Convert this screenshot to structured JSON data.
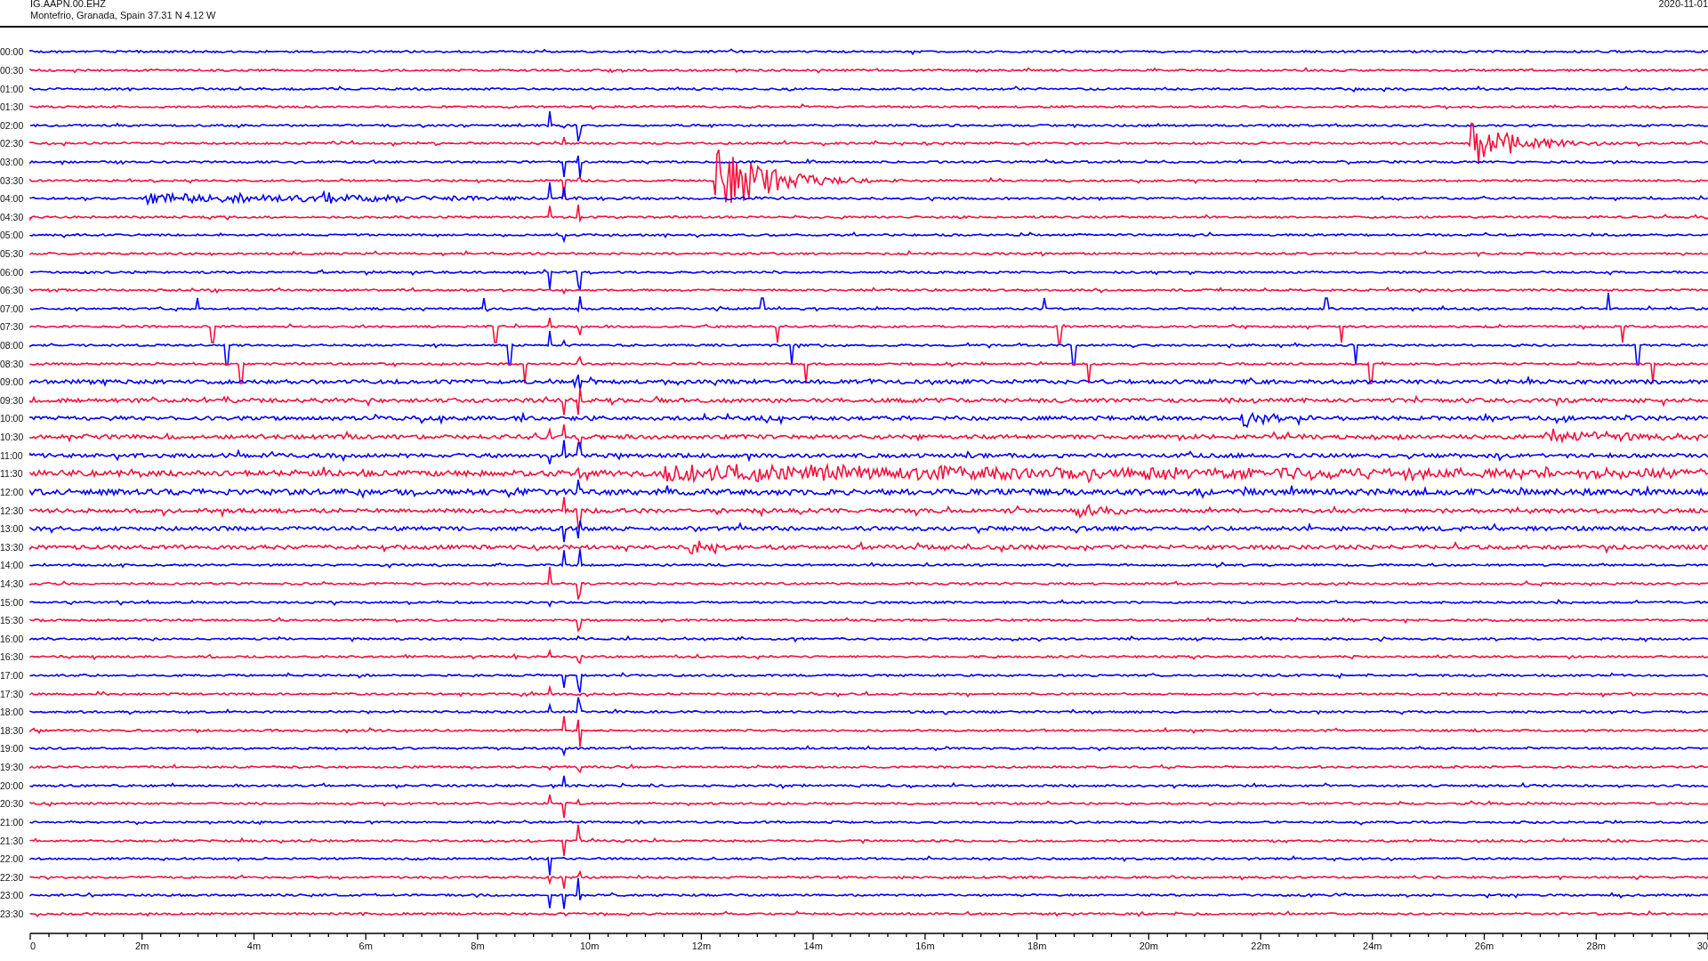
{
  "header": {
    "station": "IG.AAPN.00.EHZ",
    "location": "Montefrio, Granada, Spain  37.31 N 4.12 W",
    "date": "2020-11-01"
  },
  "rows": [
    {
      "label": "00:00",
      "color": "#0000ff"
    },
    {
      "label": "00:30",
      "color": "#f5103c"
    },
    {
      "label": "01:00",
      "color": "#0000ff"
    },
    {
      "label": "01:30",
      "color": "#f5103c"
    },
    {
      "label": "02:00",
      "color": "#0000ff"
    },
    {
      "label": "02:30",
      "color": "#f5103c"
    },
    {
      "label": "03:00",
      "color": "#0000ff"
    },
    {
      "label": "03:30",
      "color": "#f5103c"
    },
    {
      "label": "04:00",
      "color": "#0000ff"
    },
    {
      "label": "04:30",
      "color": "#f5103c"
    },
    {
      "label": "05:00",
      "color": "#0000ff"
    },
    {
      "label": "05:30",
      "color": "#f5103c"
    },
    {
      "label": "06:00",
      "color": "#0000ff"
    },
    {
      "label": "06:30",
      "color": "#f5103c"
    },
    {
      "label": "07:00",
      "color": "#0000ff"
    },
    {
      "label": "07:30",
      "color": "#f5103c"
    },
    {
      "label": "08:00",
      "color": "#0000ff"
    },
    {
      "label": "08:30",
      "color": "#f5103c"
    },
    {
      "label": "09:00",
      "color": "#0000ff"
    },
    {
      "label": "09:30",
      "color": "#f5103c"
    },
    {
      "label": "10:00",
      "color": "#0000ff"
    },
    {
      "label": "10:30",
      "color": "#f5103c"
    },
    {
      "label": "11:00",
      "color": "#0000ff"
    },
    {
      "label": "11:30",
      "color": "#f5103c"
    },
    {
      "label": "12:00",
      "color": "#0000ff"
    },
    {
      "label": "12:30",
      "color": "#f5103c"
    },
    {
      "label": "13:00",
      "color": "#0000ff"
    },
    {
      "label": "13:30",
      "color": "#f5103c"
    },
    {
      "label": "14:00",
      "color": "#0000ff"
    },
    {
      "label": "14:30",
      "color": "#f5103c"
    },
    {
      "label": "15:00",
      "color": "#0000ff"
    },
    {
      "label": "15:30",
      "color": "#f5103c"
    },
    {
      "label": "16:00",
      "color": "#0000ff"
    },
    {
      "label": "16:30",
      "color": "#f5103c"
    },
    {
      "label": "17:00",
      "color": "#0000ff"
    },
    {
      "label": "17:30",
      "color": "#f5103c"
    },
    {
      "label": "18:00",
      "color": "#0000ff"
    },
    {
      "label": "18:30",
      "color": "#f5103c"
    },
    {
      "label": "19:00",
      "color": "#0000ff"
    },
    {
      "label": "19:30",
      "color": "#f5103c"
    },
    {
      "label": "20:00",
      "color": "#0000ff"
    },
    {
      "label": "20:30",
      "color": "#f5103c"
    },
    {
      "label": "21:00",
      "color": "#0000ff"
    },
    {
      "label": "21:30",
      "color": "#f5103c"
    },
    {
      "label": "22:00",
      "color": "#0000ff"
    },
    {
      "label": "22:30",
      "color": "#f5103c"
    },
    {
      "label": "23:00",
      "color": "#0000ff"
    },
    {
      "label": "23:30",
      "color": "#f5103c"
    }
  ],
  "x_axis": {
    "ticks": [
      "0",
      "2m",
      "4m",
      "6m",
      "8m",
      "10m",
      "12m",
      "14m",
      "16m",
      "18m",
      "20m",
      "22m",
      "24m",
      "26m",
      "28m",
      "30"
    ]
  }
}
